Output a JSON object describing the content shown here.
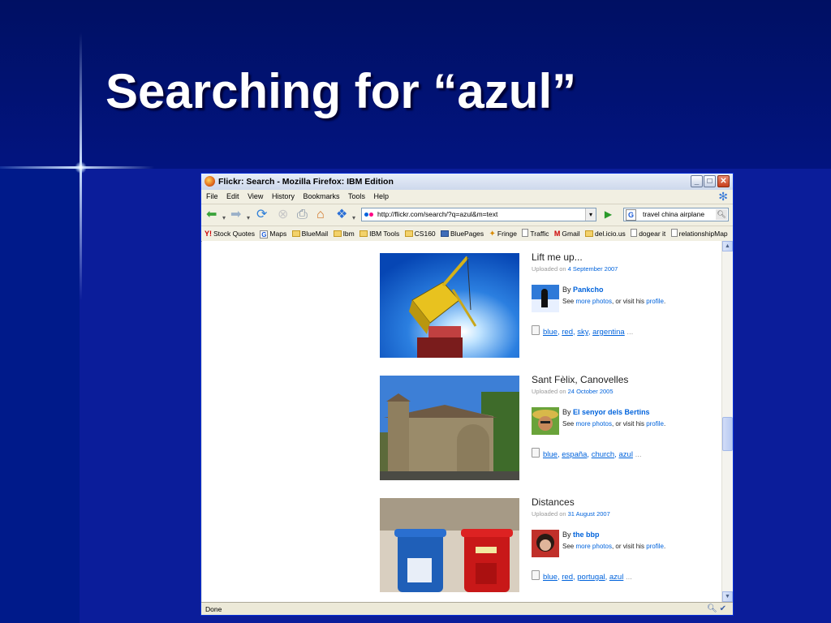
{
  "slide": {
    "title": "Searching for “azul”"
  },
  "window": {
    "title": "Flickr: Search - Mozilla Firefox: IBM Edition",
    "buttons": {
      "minimize": "_",
      "maximize": "□",
      "close": "✕"
    }
  },
  "menu": [
    "File",
    "Edit",
    "View",
    "History",
    "Bookmarks",
    "Tools",
    "Help"
  ],
  "toolbar": {
    "url": "http://flickr.com/search/?q=azul&m=text",
    "search_query": "travel china airplane",
    "search_engine_glyph": "G",
    "icons": [
      "back-icon",
      "forward-icon",
      "reload-icon",
      "stop-icon",
      "print-icon",
      "home-icon",
      "bookmark-arrow-icon"
    ]
  },
  "bookmarks": [
    {
      "label": "Stock Quotes",
      "icon": "yahoo"
    },
    {
      "label": "Maps",
      "icon": "g"
    },
    {
      "label": "BlueMail",
      "icon": "folder"
    },
    {
      "label": "Ibm",
      "icon": "folder"
    },
    {
      "label": "IBM Tools",
      "icon": "folder"
    },
    {
      "label": "CS160",
      "icon": "folder"
    },
    {
      "label": "BluePages",
      "icon": "bp"
    },
    {
      "label": "Fringe",
      "icon": "fr"
    },
    {
      "label": "Traffic",
      "icon": "page"
    },
    {
      "label": "Gmail",
      "icon": "gm"
    },
    {
      "label": "del.icio.us",
      "icon": "folder"
    },
    {
      "label": "dogear it",
      "icon": "page"
    },
    {
      "label": "relationshipMap",
      "icon": "page"
    }
  ],
  "results": [
    {
      "title": "Lift me up...",
      "uploaded_prefix": "Uploaded on",
      "date": "4 September 2007",
      "by_prefix": "By",
      "author": "Pankcho",
      "see_prefix": "See",
      "more_photos": "more photos",
      "visit_text": ", or visit his",
      "profile": "profile",
      "period": ".",
      "tags": [
        "blue",
        "red",
        "sky",
        "argentina"
      ],
      "ellipsis": "..."
    },
    {
      "title": "Sant Fèlix, Canovelles",
      "uploaded_prefix": "Uploaded on",
      "date": "24 October 2005",
      "by_prefix": "By",
      "author": "El senyor dels Bertins",
      "see_prefix": "See",
      "more_photos": "more photos",
      "visit_text": ", or visit his",
      "profile": "profile",
      "period": ".",
      "tags": [
        "blue",
        "españa",
        "church",
        "azul"
      ],
      "ellipsis": "..."
    },
    {
      "title": "Distances",
      "uploaded_prefix": "Uploaded on",
      "date": "31 August 2007",
      "by_prefix": "By",
      "author": "the bbp",
      "see_prefix": "See",
      "more_photos": "more photos",
      "visit_text": ", or visit his",
      "profile": "profile",
      "period": ".",
      "tags": [
        "blue",
        "red",
        "portugal",
        "azul"
      ],
      "ellipsis": "..."
    }
  ],
  "status": {
    "text": "Done"
  },
  "colors": {
    "slide_bg": "#0a1778",
    "link": "#0063dc",
    "title_bar": "#cdd8ec"
  }
}
